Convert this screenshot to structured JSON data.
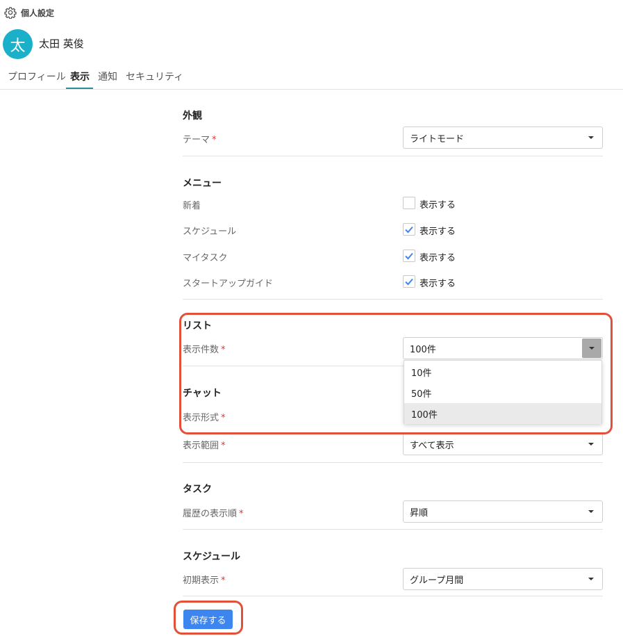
{
  "header": {
    "title": "個人設定",
    "icon": "gear-icon"
  },
  "user": {
    "avatar_char": "太",
    "avatar_color": "#1ab0c9",
    "name": "太田 英俊"
  },
  "tabs": [
    {
      "label": "プロフィール",
      "active": false
    },
    {
      "label": "表示",
      "active": true
    },
    {
      "label": "通知",
      "active": false
    },
    {
      "label": "セキュリティ",
      "active": false
    }
  ],
  "sections": {
    "appearance": {
      "title": "外観",
      "theme_label": "テーマ",
      "theme_value": "ライトモード"
    },
    "menu": {
      "title": "メニュー",
      "items": [
        {
          "label": "新着",
          "checkbox_label": "表示する",
          "checked": false
        },
        {
          "label": "スケジュール",
          "checkbox_label": "表示する",
          "checked": true
        },
        {
          "label": "マイタスク",
          "checkbox_label": "表示する",
          "checked": true
        },
        {
          "label": "スタートアップガイド",
          "checkbox_label": "表示する",
          "checked": true
        }
      ]
    },
    "list": {
      "title": "リスト",
      "count_label": "表示件数",
      "count_value": "100件",
      "options": [
        "10件",
        "50件",
        "100件"
      ],
      "selected_option": "100件"
    },
    "chat": {
      "title": "チャット",
      "format_label": "表示形式",
      "range_label": "表示範囲",
      "range_value": "すべて表示"
    },
    "task": {
      "title": "タスク",
      "history_label": "履歴の表示順",
      "history_value": "昇順"
    },
    "schedule": {
      "title": "スケジュール",
      "initial_label": "初期表示",
      "initial_value": "グループ月間"
    }
  },
  "required_mark": "*",
  "save_label": "保存する",
  "colors": {
    "accent": "#3d86f0",
    "tab_underline": "#2a8d9c",
    "highlight": "#e2503a",
    "required": "#e0382f",
    "check": "#3d86f0"
  }
}
